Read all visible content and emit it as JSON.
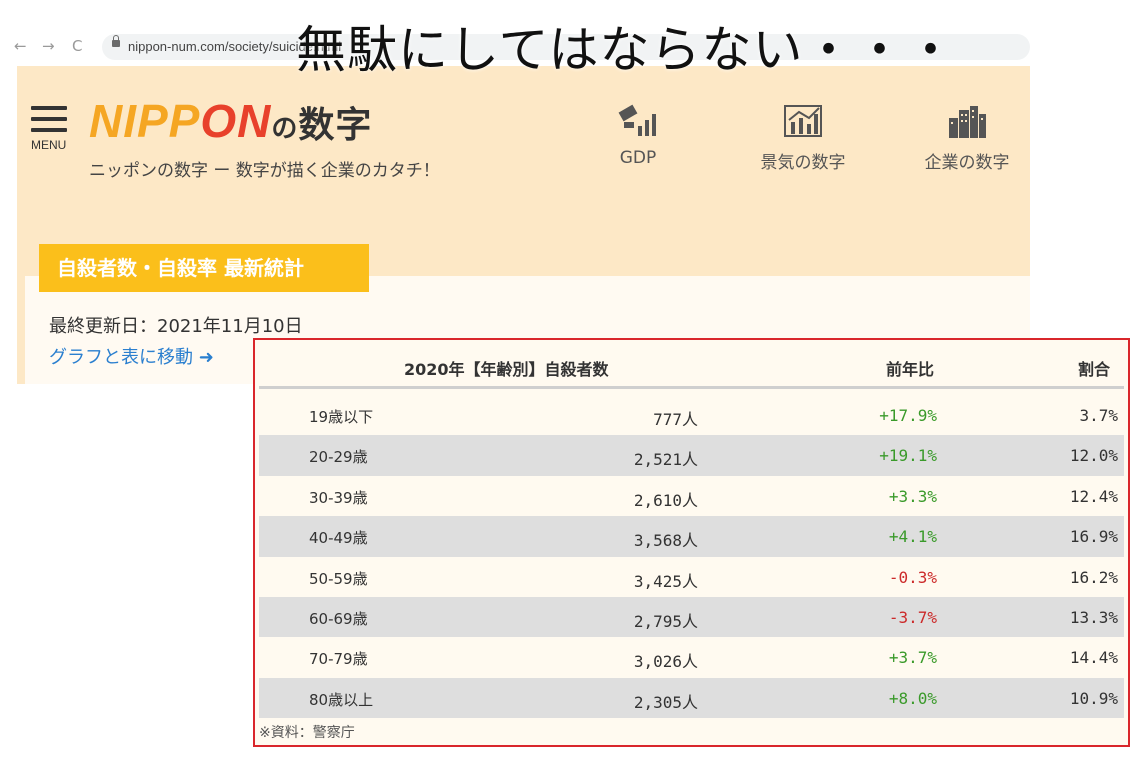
{
  "browser": {
    "url": "nippon-num.com/society/suicide.html",
    "back_icon": "←",
    "forward_icon": "→",
    "reload_icon": "C"
  },
  "overlay_title": "無駄にしてはならない・・・",
  "header": {
    "menu_label": "MENU",
    "logo_part1": "NIPP",
    "logo_part2": "ON",
    "logo_no": "の",
    "logo_kanji": "数字",
    "tagline": "ニッポンの数字 ー 数字が描く企業のカタチ！",
    "nav": [
      {
        "label": "GDP",
        "icon": "money-chart-icon"
      },
      {
        "label": "景気の数字",
        "icon": "line-chart-icon"
      },
      {
        "label": "企業の数字",
        "icon": "buildings-icon"
      }
    ]
  },
  "section": {
    "tag": "自殺者数・自殺率 最新統計",
    "updated": "最終更新日：2021年11月10日",
    "jump_link": "グラフと表に移動 ➜"
  },
  "table": {
    "headers": [
      "2020年【年齢別】自殺者数",
      "前年比",
      "割合"
    ],
    "rows": [
      {
        "age": "19歳以下",
        "count": "777人",
        "yoy": "+17.9%",
        "share": "3.7%"
      },
      {
        "age": "20-29歳",
        "count": "2,521人",
        "yoy": "+19.1%",
        "share": "12.0%"
      },
      {
        "age": "30-39歳",
        "count": "2,610人",
        "yoy": "+3.3%",
        "share": "12.4%"
      },
      {
        "age": "40-49歳",
        "count": "3,568人",
        "yoy": "+4.1%",
        "share": "16.9%"
      },
      {
        "age": "50-59歳",
        "count": "3,425人",
        "yoy": "-0.3%",
        "share": "16.2%"
      },
      {
        "age": "60-69歳",
        "count": "2,795人",
        "yoy": "-3.7%",
        "share": "13.3%"
      },
      {
        "age": "70-79歳",
        "count": "3,026人",
        "yoy": "+3.7%",
        "share": "14.4%"
      },
      {
        "age": "80歳以上",
        "count": "2,305人",
        "yoy": "+8.0%",
        "share": "10.9%"
      }
    ],
    "source": "※資料：警察庁"
  },
  "colors": {
    "accent": "#fbbf1b",
    "header_bg": "#fde8c6",
    "highlight_border": "#d9262b",
    "positive": "#3a9a2a",
    "negative": "#cc2a2a",
    "link": "#2a7fcf"
  }
}
